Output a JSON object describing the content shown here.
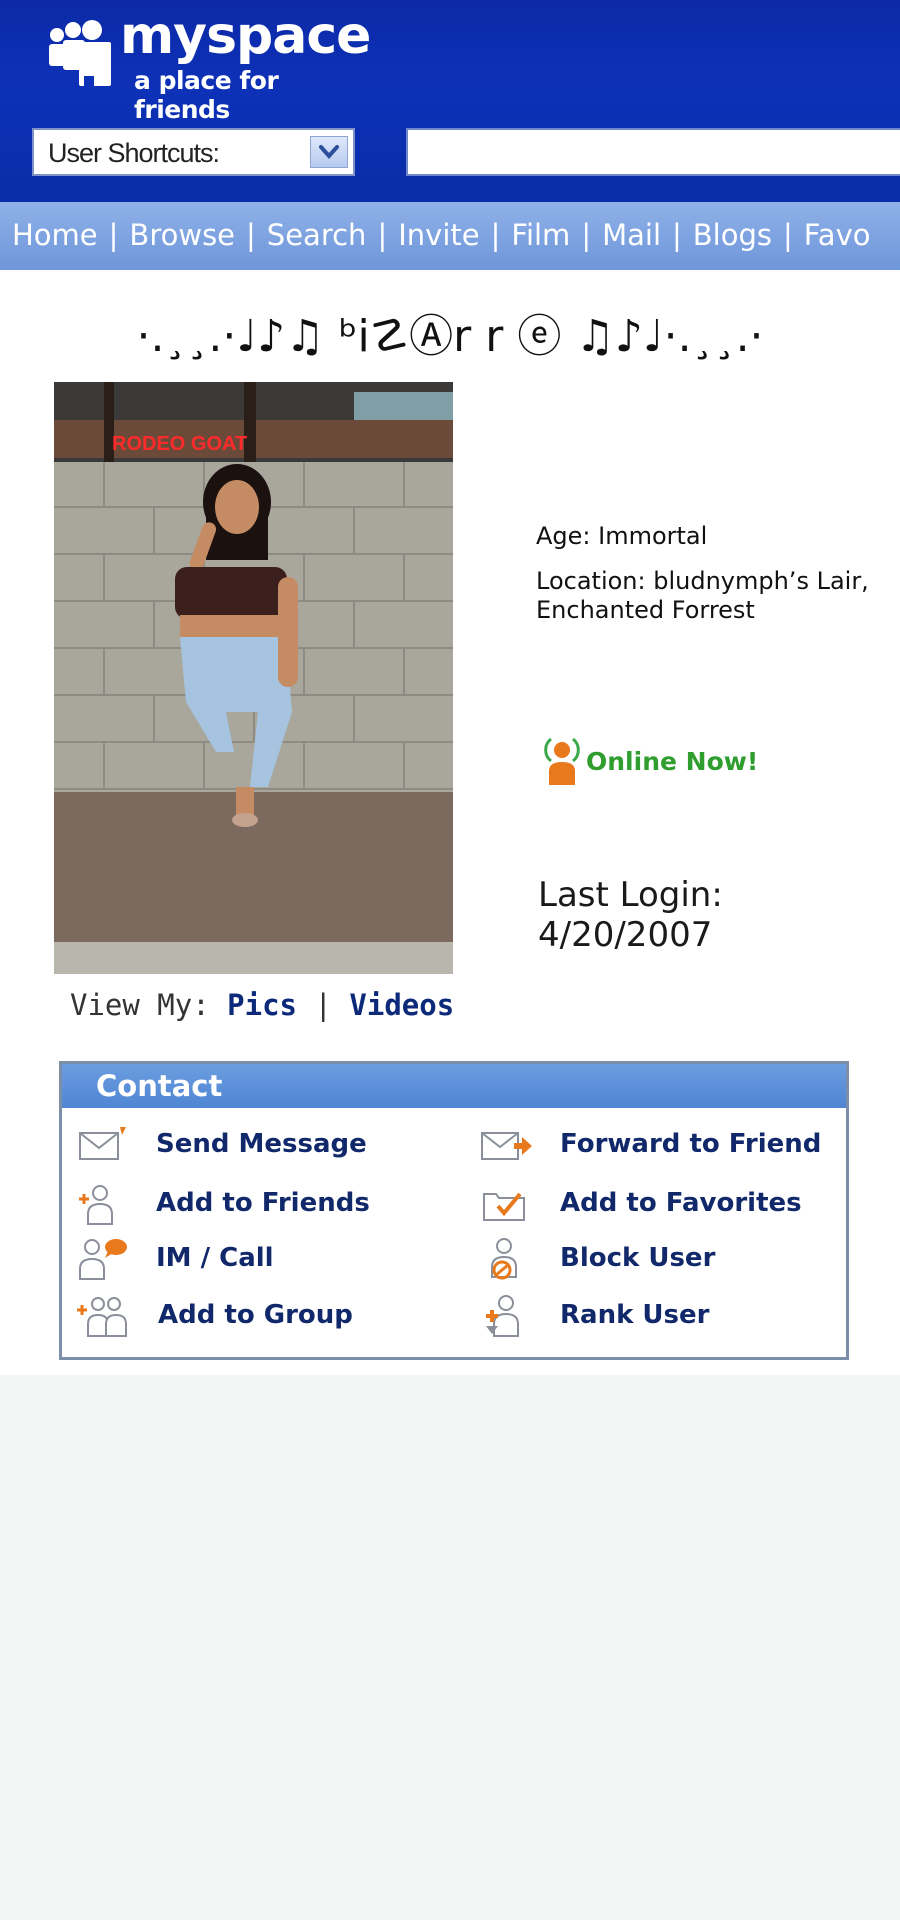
{
  "header": {
    "logo_word": "myspace",
    "logo_tagline": "a place for friends",
    "shortcuts_label": "User Shortcuts:",
    "search_value": ""
  },
  "nav": {
    "items": [
      "Home",
      "Browse",
      "Search",
      "Invite",
      "Film",
      "Mail",
      "Blogs",
      "Favo"
    ],
    "separator": "|"
  },
  "profile": {
    "display_name": "·.¸¸.·♩♪♫ ᵇi☡Ⓐr r ⓔ ♫♪♩·.¸¸.·",
    "age": "Age: Immortal",
    "location": "Location: bludnymph’s Lair, Enchanted Forrest",
    "online_status": "Online Now!",
    "last_login_label": "Last Login:",
    "last_login_date": "4/20/2007",
    "photo_sign": "RODEO GOAT",
    "view_my_label": "View My:",
    "view_my_pics": "Pics",
    "view_my_sep": "|",
    "view_my_videos": "Videos"
  },
  "contact": {
    "title": "Contact",
    "items": [
      {
        "label": "Send Message",
        "icon": "envelope-icon"
      },
      {
        "label": "Forward to Friend",
        "icon": "forward-envelope-icon"
      },
      {
        "label": "Add to Friends",
        "icon": "add-friend-icon"
      },
      {
        "label": "Add to Favorites",
        "icon": "favorites-folder-icon"
      },
      {
        "label": "IM / Call",
        "icon": "im-call-icon"
      },
      {
        "label": "Block User",
        "icon": "block-user-icon"
      },
      {
        "label": "Add to Group",
        "icon": "add-group-icon"
      },
      {
        "label": "Rank User",
        "icon": "rank-user-icon"
      }
    ]
  },
  "colors": {
    "header_blue": "#0d31b7",
    "nav_blue": "#7fa3e0",
    "contact_header": "#5b8fd8",
    "link_navy": "#11286a",
    "online_green": "#2f9e2f",
    "icon_orange": "#e8791c"
  }
}
